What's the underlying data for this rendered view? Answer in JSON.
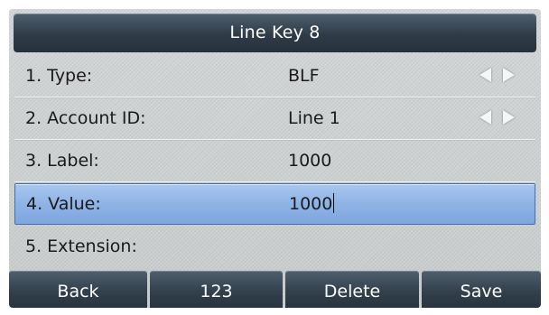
{
  "title": "Line Key 8",
  "fields": [
    {
      "label": "1. Type:",
      "value": "BLF",
      "has_arrows": true
    },
    {
      "label": "2. Account ID:",
      "value": "Line 1",
      "has_arrows": true
    },
    {
      "label": "3. Label:",
      "value": "1000",
      "has_arrows": false
    },
    {
      "label": "4. Value:",
      "value": "1000",
      "has_arrows": false,
      "selected": true
    },
    {
      "label": "5. Extension:",
      "value": "",
      "has_arrows": false
    }
  ],
  "softkeys": [
    {
      "label": "Back"
    },
    {
      "label": "123"
    },
    {
      "label": "Delete"
    },
    {
      "label": "Save"
    }
  ],
  "icons": {
    "left_arrow": "triangle-left-icon",
    "right_arrow": "triangle-right-icon"
  },
  "colors": {
    "title_bar": "#2f3c48",
    "selected_row": "#8eb3e6",
    "selected_border": "#3d6fb8",
    "softkey": "#33414d",
    "background": "#cfd2d3"
  }
}
